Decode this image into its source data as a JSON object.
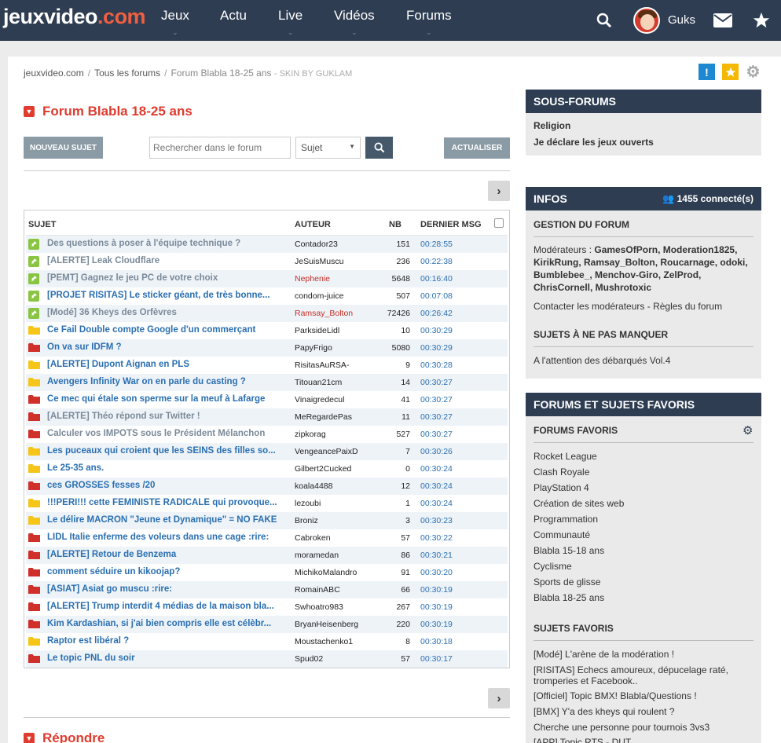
{
  "header": {
    "logo_main": "jeuxvideo",
    "logo_ext": ".com",
    "nav": [
      "Jeux",
      "Actu",
      "Live",
      "Vidéos",
      "Forums"
    ],
    "username": "Guks"
  },
  "breadcrumb": {
    "home": "jeuxvideo.com",
    "forums": "Tous les forums",
    "current": "Forum Blabla 18-25 ans",
    "skin": "- SKIN BY GUKLAM"
  },
  "forum": {
    "title": "Forum Blabla 18-25 ans",
    "new_topic": "NOUVEAU SUJET",
    "search_placeholder": "Rechercher dans le forum",
    "search_scope": "Sujet",
    "refresh": "ACTUALISER",
    "reply_title": "Répondre"
  },
  "table": {
    "headers": {
      "subject": "SUJET",
      "author": "AUTEUR",
      "count": "NB",
      "last": "DERNIER MSG"
    },
    "rows": [
      {
        "type": "pin",
        "subject": "Des questions à poser à l'équipe technique ?",
        "author": "Contador23",
        "mod": false,
        "nb": "151",
        "last": "00:28:55",
        "read": true
      },
      {
        "type": "pin",
        "subject": "[ALERTE] Leak Cloudflare",
        "author": "JeSuisMuscu",
        "mod": false,
        "nb": "236",
        "last": "00:22:38",
        "read": true
      },
      {
        "type": "pin",
        "subject": "[PEMT] Gagnez le jeu PC de votre choix",
        "author": "Nephenie",
        "mod": true,
        "nb": "5648",
        "last": "00:16:40",
        "read": true
      },
      {
        "type": "pin",
        "subject": "[PROJET RISITAS] Le sticker géant, de très bonne...",
        "author": "condom-juice",
        "mod": false,
        "nb": "507",
        "last": "00:07:08",
        "read": false
      },
      {
        "type": "pin",
        "subject": "[Modé] 36 Kheys des Orfèvres",
        "author": "Ramsay_Bolton",
        "mod": true,
        "nb": "72426",
        "last": "00:26:42",
        "read": true
      },
      {
        "type": "yellow",
        "subject": "Ce Fail Double compte Google d'un commerçant",
        "author": "ParksideLidl",
        "mod": false,
        "nb": "10",
        "last": "00:30:29",
        "read": false
      },
      {
        "type": "red",
        "subject": "On va sur IDFM ?",
        "author": "PapyFrigo",
        "mod": false,
        "nb": "5080",
        "last": "00:30:29",
        "read": false
      },
      {
        "type": "yellow",
        "subject": "[ALERTE] Dupont Aignan en PLS",
        "author": "RisitasAuRSA-",
        "mod": false,
        "nb": "9",
        "last": "00:30:28",
        "read": false
      },
      {
        "type": "yellow",
        "subject": "Avengers Infinity War on en parle du casting ?",
        "author": "Titouan21cm",
        "mod": false,
        "nb": "14",
        "last": "00:30:27",
        "read": false
      },
      {
        "type": "red",
        "subject": "Ce mec qui étale son sperme sur la meuf à Lafarge",
        "author": "Vinaigredecul",
        "mod": false,
        "nb": "41",
        "last": "00:30:27",
        "read": false
      },
      {
        "type": "red",
        "subject": "[ALERTE] Théo répond sur Twitter !",
        "author": "MeRegardePas",
        "mod": false,
        "nb": "11",
        "last": "00:30:27",
        "read": true
      },
      {
        "type": "red",
        "subject": "Calculer vos IMPOTS sous le Président Mélanchon",
        "author": "zipkorag",
        "mod": false,
        "nb": "527",
        "last": "00:30:27",
        "read": true
      },
      {
        "type": "yellow",
        "subject": "Les puceaux qui croient que les SEINS des filles so...",
        "author": "VengeancePaixD",
        "mod": false,
        "nb": "7",
        "last": "00:30:26",
        "read": false
      },
      {
        "type": "yellow",
        "subject": "Le 25-35 ans.",
        "author": "Gilbert2Cucked",
        "mod": false,
        "nb": "0",
        "last": "00:30:24",
        "read": false
      },
      {
        "type": "red",
        "subject": "ces GROSSES fesses /20",
        "author": "koala4488",
        "mod": false,
        "nb": "12",
        "last": "00:30:24",
        "read": false
      },
      {
        "type": "yellow",
        "subject": "!!!PERI!!! cette FEMINISTE RADICALE qui provoque...",
        "author": "lezoubi",
        "mod": false,
        "nb": "1",
        "last": "00:30:24",
        "read": false
      },
      {
        "type": "yellow",
        "subject": "Le délire MACRON \"Jeune et Dynamique\" = NO FAKE",
        "author": "Broniz",
        "mod": false,
        "nb": "3",
        "last": "00:30:23",
        "read": false
      },
      {
        "type": "red",
        "subject": "LIDL Italie enferme des voleurs dans une cage :rire:",
        "author": "Cabroken",
        "mod": false,
        "nb": "57",
        "last": "00:30:22",
        "read": false
      },
      {
        "type": "red",
        "subject": "[ALERTE] Retour de Benzema",
        "author": "moramedan",
        "mod": false,
        "nb": "86",
        "last": "00:30:21",
        "read": false
      },
      {
        "type": "red",
        "subject": "comment séduire un kikoojap?",
        "author": "MichikoMalandro",
        "mod": false,
        "nb": "91",
        "last": "00:30:20",
        "read": false
      },
      {
        "type": "red",
        "subject": "[ASIAT] Asiat go muscu :rire:",
        "author": "RomainABC",
        "mod": false,
        "nb": "66",
        "last": "00:30:19",
        "read": false
      },
      {
        "type": "red",
        "subject": "[ALERTE] Trump interdit 4 médias de la maison bla...",
        "author": "Swhoatro983",
        "mod": false,
        "nb": "267",
        "last": "00:30:19",
        "read": false
      },
      {
        "type": "red",
        "subject": "Kim Kardashian, si j'ai bien compris elle est célèbr...",
        "author": "BryanHeisenberg",
        "mod": false,
        "nb": "220",
        "last": "00:30:19",
        "read": false
      },
      {
        "type": "yellow",
        "subject": "Raptor est libéral ?",
        "author": "Moustachenko1",
        "mod": false,
        "nb": "8",
        "last": "00:30:18",
        "read": false
      },
      {
        "type": "red",
        "subject": "Le topic PNL du soir",
        "author": "Spud02",
        "mod": false,
        "nb": "57",
        "last": "00:30:17",
        "read": false
      }
    ]
  },
  "sidebar": {
    "subforums": {
      "title": "SOUS-FORUMS",
      "items": [
        "Religion",
        "Je déclare les jeux ouverts"
      ]
    },
    "infos": {
      "title": "INFOS",
      "connected": "1455 connecté(s)",
      "management_title": "GESTION DU FORUM",
      "moderators_label": "Modérateurs : ",
      "moderators": "GamesOfPorn, Moderation1825, KirikRung, Ramsay_Bolton, Roucarnage, odoki, Bumblebee_, Menchov-Giro, ZelProd, ChrisCornell, Mushrotoxic",
      "contact": "Contacter les modérateurs - Règles du forum",
      "dont_miss_title": "SUJETS À NE PAS MANQUER",
      "dont_miss_item": "A l'attention des débarqués Vol.4"
    },
    "favorites": {
      "title": "FORUMS ET SUJETS FAVORIS",
      "forums_title": "FORUMS FAVORIS",
      "forums": [
        "Rocket League",
        "Clash Royale",
        "PlayStation 4",
        "Création de sites web",
        "Programmation",
        "Communauté",
        "Blabla 15-18 ans",
        "Cyclisme",
        "Sports de glisse",
        "Blabla 18-25 ans"
      ],
      "topics_title": "SUJETS FAVORIS",
      "topics": [
        "[Modé] L'arène de la modération !",
        "[RISITAS] Echecs amoureux, dépucelage raté, tromperies et Facebook..",
        "[Officiel] Topic BMX! Blabla/Questions !",
        "[BMX] Y'a des kheys qui roulent ?",
        "Cherche une personne pour tournois 3vs3",
        "[APP] Topic RTS - DUT"
      ]
    }
  },
  "colors": {
    "header_bg": "#2e3d52",
    "accent_red": "#e03b2e",
    "link_blue": "#2a6fb1",
    "pin_green": "#8ac542",
    "folder_yellow": "#f5c518",
    "folder_red": "#d0302a"
  }
}
